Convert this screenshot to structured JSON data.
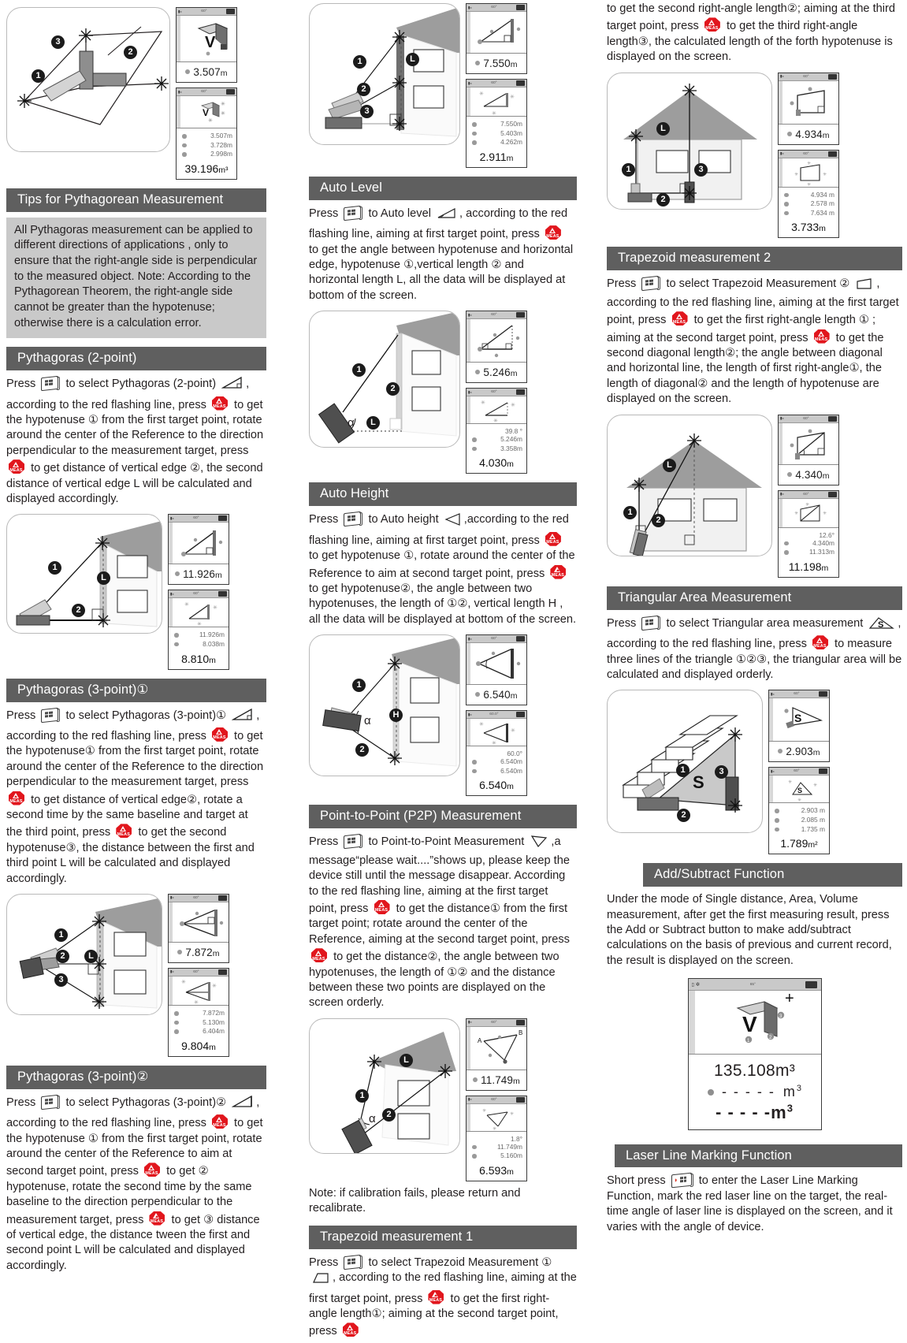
{
  "sections": {
    "tips": {
      "heading": "Tips for Pythagorean Measurement",
      "body": "All Pythagoras measurement can be applied to different directions of applications , only to ensure that the right-angle side is perpendicular to the measured object. Note: According to the Pythagorean Theorem, the right-angle side cannot be greater than the hypotenuse; otherwise there is a calculation error."
    },
    "pyth2": {
      "heading": "Pythagoras (2-point)",
      "p1": "Press",
      "p2": "to select Pythagoras (2-point)",
      "p3": ", according to the red flashing line, press",
      "p4": "to get the hypotenuse ① from the first target point,  rotate around the center of the Reference to the direction perpendicular to the measurement target, press",
      "p5": "to get distance of vertical edge ②, the second distance of vertical edge L will be calculated and displayed accordingly."
    },
    "pyth3a": {
      "heading": "Pythagoras (3-point)①",
      "p1": "Press",
      "p2": "to select Pythagoras (3-point)①",
      "p3": ", according to the red flashing line, press",
      "p4": "to get the hypotenuse① from the first target point,  rotate around the center of the Reference to the direction perpendicular to the measurement target, press",
      "p5": "to get distance of vertical edge②, rotate a second time by the same baseline and target at the third point, press",
      "p6": "to get the second hypotenuse③, the distance between the first and third point L will be calculated and displayed accordingly."
    },
    "pyth3b": {
      "heading": "Pythagoras (3-point)②",
      "p1": "Press",
      "p2": "to select Pythagoras (3-point)②",
      "p3": ", according to the red flashing line, press",
      "p4": "to get the hypotenuse ① from the first target point,  rotate around the center of the Reference to aim at second target point, press",
      "p5": "to get ② hypotenuse, rotate the second time by the same baseline to the direction perpendicular to the measurement target, press",
      "p6": "to get ③ distance of vertical edge,  the distance tween the first and second point L will be calculated and displayed accordingly."
    },
    "autolevel": {
      "heading": "Auto Level",
      "p1": "Press",
      "p2": "to Auto level",
      "p3": ", according to the red flashing line, aiming at first target point, press",
      "p4": "to get the angle between hypotenuse and horizontal edge, hypotenuse ①,vertical length ② and horizontal length L, all the data will be displayed at bottom of the screen."
    },
    "autoheight": {
      "heading": "Auto Height",
      "p1": "Press",
      "p2": "to Auto height",
      "p3": ",according to the red flashing line, aiming at first target point, press",
      "p4": "to get hypotenuse ①,  rotate around the center of the Reference to aim at second target point, press",
      "p5": "to get hypotenuse②, the angle between two hypotenuses, the length of ①②, vertical length H , all the data will be displayed at bottom of the screen."
    },
    "p2p": {
      "heading": "Point-to-Point (P2P) Measurement",
      "p1": "Press",
      "p2": "to Point-to-Point Measurement",
      "p3": ",a message“please wait....”shows up, please keep the device still until the message disappear. According to the red flashing line, aiming at the first target point, press",
      "p4": "to get the distance① from the first target point; rotate around the center of the Reference, aiming at the second target point, press",
      "p5": "to get the distance②, the angle between two hypotenuses, the length of ①② and the distance between these two points are displayed on the screen orderly.",
      "note": "Note: if calibration fails, please return and recalibrate."
    },
    "trap1": {
      "heading": "Trapezoid measurement 1",
      "p1": "Press",
      "p2": "to select Trapezoid Measurement ①",
      "p3": ", according to the red flashing line, aiming at the first target point, press",
      "p4": "to get the first right-angle length①; aiming at the second target point, press",
      "p5": "to get the second right-angle length②; aiming at the third target point, press",
      "p6": "to get the third right-angle length③, the calculated length of the forth hypotenuse is displayed on the screen."
    },
    "trap2": {
      "heading": "Trapezoid measurement 2",
      "p1": "Press",
      "p2": "to select Trapezoid Measurement ②",
      "p3": ", according to the red flashing line, aiming at the first target point, press",
      "p4": "to get the first right-angle length ① ; aiming at the second target point, press",
      "p5": "to get the second diagonal length②; the angle between diagonal and horizontal line, the length of first right-angle①, the length of diagonal② and the length of hypotenuse are displayed on the screen."
    },
    "triarea": {
      "heading": "Triangular Area Measurement",
      "p1": "Press",
      "p2": "to select Triangular area measurement",
      "p3": ", according to the red flashing line, press",
      "p4": "to measure three lines of the triangle ①②③, the triangular area will be calculated and displayed orderly."
    },
    "addsub": {
      "heading": "Add/Subtract Function",
      "body": "Under the mode of Single distance, Area, Volume measurement, after get the first measuring result, press the Add or Subtract button to make add/subtract calculations on the basis of previous and current record, the result is displayed on the screen."
    },
    "laserline": {
      "heading": "Laser Line Marking Function",
      "p1": "Short press",
      "p2": "to enter the Laser Line Marking Function, mark the red laser line on the target, the real-time angle of laser line is displayed on the screen, and it varies with the angle of device."
    }
  },
  "displays": {
    "volume_top": {
      "status_angle": "60°",
      "value": "3.507",
      "unit": "m"
    },
    "volume_list": {
      "status_angle": "60°",
      "rows": [
        "3.507m",
        "3.728m",
        "2.998m"
      ],
      "total": "39.196",
      "total_unit": "m³"
    },
    "pyth2_a": {
      "status_angle": "60°",
      "value": "11.926",
      "unit": "m"
    },
    "pyth2_b": {
      "status_angle": "60°",
      "rows": [
        "11.926m",
        "8.038m"
      ],
      "total": "8.810",
      "total_unit": "m"
    },
    "pyth3a_a": {
      "status_angle": "60°",
      "value": "7.872",
      "unit": "m"
    },
    "pyth3a_b": {
      "status_angle": "60°",
      "rows": [
        "7.872m",
        "5.130m",
        "6.404m"
      ],
      "total": "9.804",
      "total_unit": "m"
    },
    "pyth3b_a": {
      "status_angle": "60°",
      "value": "7.550",
      "unit": "m"
    },
    "pyth3b_b": {
      "status_angle": "60°",
      "rows": [
        "7.550m",
        "5.403m",
        "4.262m"
      ],
      "total": "2.911",
      "total_unit": "m"
    },
    "autolevel_a": {
      "status_angle": "60°",
      "value": "5.246",
      "unit": "m"
    },
    "autolevel_b": {
      "status_angle": "60°",
      "angle": "39.8 °",
      "rows": [
        "5.246m",
        "3.358m"
      ],
      "total": "4.030",
      "total_unit": "m"
    },
    "autoheight_a": {
      "status_angle": "60°",
      "value": "6.540",
      "unit": "m"
    },
    "autoheight_b": {
      "status_angle": "60.0°",
      "angle": "60.0°",
      "rows": [
        "6.540m",
        "6.540m"
      ],
      "total": "6.540",
      "total_unit": "m"
    },
    "p2p_a": {
      "status_angle": "60°",
      "value": "11.749",
      "unit": "m"
    },
    "p2p_b": {
      "status_angle": "60°",
      "angle": "1.8°",
      "rows": [
        "11.749m",
        "5.160m"
      ],
      "total": "6.593",
      "total_unit": "m"
    },
    "trap1_a": {
      "status_angle": "60°",
      "value": "4.934",
      "unit": "m"
    },
    "trap1_b": {
      "status_angle": "60°",
      "rows": [
        "4.934 m",
        "2.578 m",
        "7.634 m"
      ],
      "total": "3.733",
      "total_unit": "m"
    },
    "trap2_a": {
      "status_angle": "60°",
      "value": "4.340",
      "unit": "m"
    },
    "trap2_b": {
      "status_angle": "60°",
      "angle": "12.6°",
      "rows": [
        "4.340m",
        "11.313m"
      ],
      "total": "11.198",
      "total_unit": "m"
    },
    "triarea_a": {
      "status_angle": "60°",
      "value": "2.903",
      "unit": "m"
    },
    "triarea_b": {
      "status_angle": "60°",
      "rows": [
        "2.903 m",
        "2.085 m",
        "1.735 m"
      ],
      "total": "1.789",
      "total_unit": "m²"
    },
    "addsub": {
      "status_angle": "65°",
      "main_value": "135.108m³",
      "row_value": "- - - - -",
      "row_unit": "m³",
      "last_value": "- - - - -",
      "last_unit": "m",
      "last_exp": "3",
      "plus": "+"
    }
  },
  "labels": {
    "badge1": "1",
    "badge2": "2",
    "badge3": "3",
    "badgeL": "L",
    "badgeH": "H",
    "alpha": "α",
    "area_s": "S",
    "vol_v": "V"
  },
  "icons": {
    "menu": "menu-key-icon",
    "meas": "meas-key-icon",
    "meas_text": "MEAS"
  },
  "colors": {
    "section_bar": "#5f5f5f",
    "tip_box": "#c9c9c9",
    "meas_red": "#e1161d",
    "roof_gray": "#9d9d9d"
  }
}
